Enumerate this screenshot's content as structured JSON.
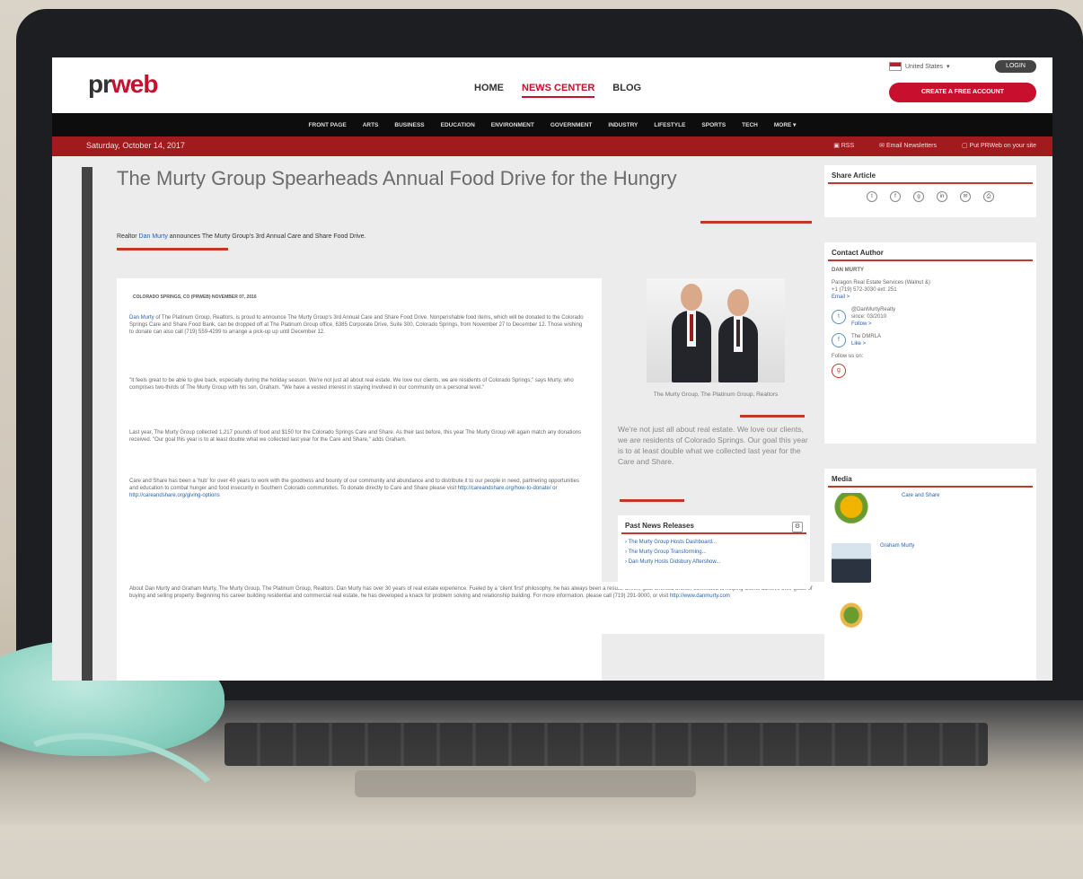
{
  "header": {
    "logo": "prweb",
    "nav": [
      "HOME",
      "NEWS CENTER",
      "BLOG"
    ],
    "locale": "United States",
    "login_label": "LOGIN",
    "create_label": "CREATE A FREE ACCOUNT"
  },
  "categories": [
    "FRONT PAGE",
    "ARTS",
    "BUSINESS",
    "EDUCATION",
    "ENVIRONMENT",
    "GOVERNMENT",
    "INDUSTRY",
    "LIFESTYLE",
    "SPORTS",
    "TECH",
    "MORE ▾"
  ],
  "datebar": {
    "date": "Saturday, October 14, 2017",
    "rss": "RSS",
    "email": "Email Newsletters",
    "put": "Put PRWeb on your site"
  },
  "article": {
    "headline": "The Murty Group Spearheads Annual Food Drive for the Hungry",
    "subhead_prefix": "Realtor",
    "subhead_link": "Dan Murty",
    "subhead_rest": "announces The Murty Group's 3rd Annual Care and Share Food Drive.",
    "dateline": "COLORADO SPRINGS, CO (PRWEB) NOVEMBER 07, 2016",
    "p1_link": "Dan Murty",
    "p1": "of The Platinum Group, Realtors, is proud to announce The Murty Group's 3rd Annual Care and Share Food Drive. Nonperishable food items, which will be donated to the Colorado Springs Care and Share Food Bank, can be dropped off at The Platinum Group office, 6385 Corporate Drive, Suite 300, Colorado Springs, from November 27 to December 12. Those wishing to donate can also call (719) 559-4299 to arrange a pick-up up until December 12.",
    "p2": "\"It feels great to be able to give back, especially during the holiday season. We're not just all about real estate. We love our clients, we are residents of Colorado Springs,\" says Murty, who comprises two-thirds of The Murty Group with his son, Graham. \"We have a vested interest in staying involved in our community on a personal level.\"",
    "p3": "Last year, The Murty Group collected 1,217 pounds of food and $150 for the Colorado Springs Care and Share. As their last before, this year The Murty Group will again match any donations received. \"Our goal this year is to at least double what we collected last year for the Care and Share,\" adds Graham.",
    "p4": "Care and Share has been a 'hub' for over 40 years to work with the goodness and bounty of our community and abundance and to distribute it to our people in need, partnering opportunities and education to combat hunger and food insecurity in Southern Colorado communities. To donate directly to Care and Share please visit",
    "p4_links": "http://careandshare.org/how-to-donate/ or http://careandshare.org/giving-options",
    "about": "About Dan Murty and Graham Murty, The Murty Group, The Platinum Group, Realtors: Dan Murty has over 30 years of real estate experience. Fueled by a 'client first' philosophy, he has always been a results-driven, goal-oriented broker, committed to helping clients achieve their goals of buying and selling property. Beginning his career building residential and commercial real estate, he has developed a knack for problem solving and relationship building. For more information, please call (719) 291-9000, or visit",
    "about_link": "http://www.danmurty.com"
  },
  "photo": {
    "caption": "The Murty Group, The Platinum Group, Realtors"
  },
  "quote": "We're not just all about real estate. We love our clients, we are residents of Colorado Springs. Our goal this year is to at least double what we collected last year for the Care and Share.",
  "past_news": {
    "title": "Past News Releases",
    "items": [
      "The Murty Group Hosts Dashboard...",
      "The Murty Group Transforming...",
      "Dan Murty Hosts Didsbury Aftershow..."
    ]
  },
  "sidebar": {
    "share_title": "Share Article",
    "contact_title": "Contact Author",
    "contact_name": "DAN MURTY",
    "contact_company": "Paragon Real Estate Services (Walnut &)",
    "contact_phone": "+1 (719) 572-3030 ext: 251",
    "contact_email": "Email >",
    "twitter_handle": "@DanMurtyRealty",
    "twitter_since": "since: 03/2010",
    "twitter_follow": "Follow >",
    "dm_handle": "The DMRLA",
    "dm_like": "Like >",
    "follow_label": "Follow us on:",
    "media_title": "Media",
    "media_items": [
      "Care and Share",
      "Graham Murty"
    ]
  }
}
